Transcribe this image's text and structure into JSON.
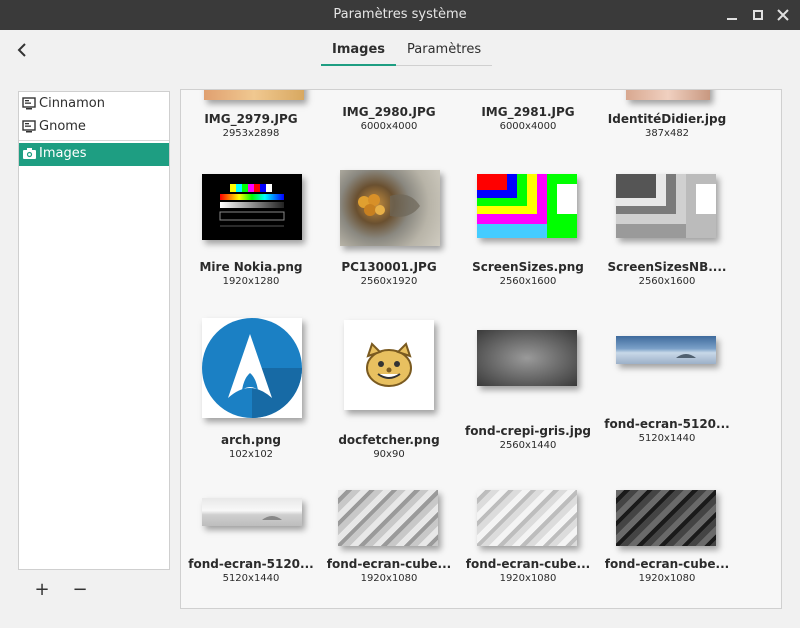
{
  "window": {
    "title": "Paramètres système"
  },
  "tabs": [
    {
      "label": "Images"
    },
    {
      "label": "Paramètres"
    }
  ],
  "sidebar": {
    "items": [
      {
        "label": "Cinnamon",
        "icon": "monitor-icon"
      },
      {
        "label": "Gnome",
        "icon": "monitor-icon"
      },
      {
        "label": "Images",
        "icon": "camera-icon"
      }
    ],
    "add_label": "+",
    "remove_label": "−"
  },
  "images": [
    {
      "name": "IMG_2979.JPG",
      "dims": "2953x2898"
    },
    {
      "name": "IMG_2980.JPG",
      "dims": "6000x4000"
    },
    {
      "name": "IMG_2981.JPG",
      "dims": "6000x4000"
    },
    {
      "name": "IdentitéDidier.jpg",
      "dims": "387x482"
    },
    {
      "name": "Mire Nokia.png",
      "dims": "1920x1280"
    },
    {
      "name": "PC130001.JPG",
      "dims": "2560x1920"
    },
    {
      "name": "ScreenSizes.png",
      "dims": "2560x1600"
    },
    {
      "name": "ScreenSizesNB....",
      "dims": "2560x1600"
    },
    {
      "name": "arch.png",
      "dims": "102x102"
    },
    {
      "name": "docfetcher.png",
      "dims": "90x90"
    },
    {
      "name": "fond-crepi-gris.jpg",
      "dims": "2560x1440"
    },
    {
      "name": "fond-ecran-5120...",
      "dims": "5120x1440"
    },
    {
      "name": "fond-ecran-5120...",
      "dims": "5120x1440"
    },
    {
      "name": "fond-ecran-cube...",
      "dims": "1920x1080"
    },
    {
      "name": "fond-ecran-cube...",
      "dims": "1920x1080"
    },
    {
      "name": "fond-ecran-cube...",
      "dims": "1920x1080"
    }
  ]
}
